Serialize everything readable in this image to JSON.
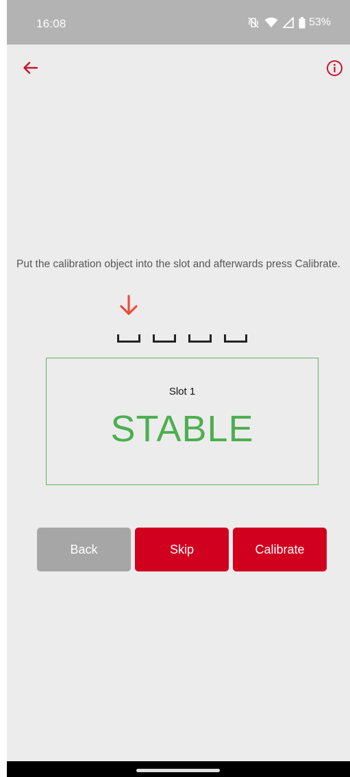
{
  "status_bar": {
    "time": "16:08",
    "battery_percent": "53%",
    "icons": [
      "vibrate-off-icon",
      "wifi-icon",
      "signal-icon",
      "battery-icon"
    ]
  },
  "toolbar": {
    "back_icon": "arrow-left-icon",
    "info_icon": "info-circle-icon",
    "accent_color": "#c8102e"
  },
  "main": {
    "instruction": "Put the calibration object into the slot and afterwards press Calibrate.",
    "active_slot_index": 1,
    "slot_count": 4,
    "slot_label": "Slot 1",
    "status": "STABLE",
    "status_color": "#4caf50"
  },
  "buttons": {
    "back_label": "Back",
    "skip_label": "Skip",
    "calibrate_label": "Calibrate",
    "primary_color": "#d1001f",
    "secondary_color": "#a6a6a6"
  }
}
